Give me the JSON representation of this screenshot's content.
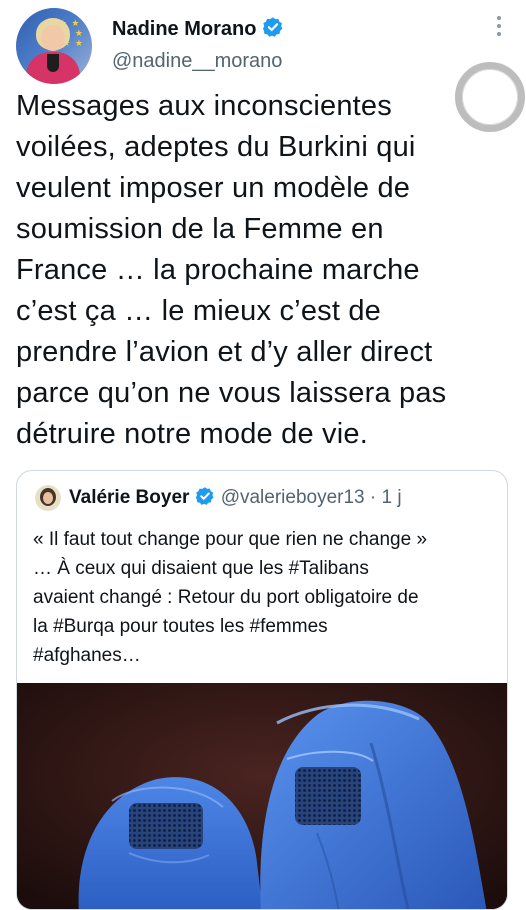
{
  "author": {
    "display_name": "Nadine Morano",
    "handle": "@nadine__morano",
    "verified": true
  },
  "tweet": {
    "lines": [
      "Messages aux inconscientes",
      "voilées, adeptes du Burkini qui",
      "veulent imposer un modèle de",
      "soumission de la Femme en",
      "France … la prochaine marche",
      "c’est ça … le mieux c’est de",
      "prendre l’avion et d’y aller direct",
      "parce qu’on ne vous laissera pas",
      "détruire notre mode de vie."
    ]
  },
  "quoted_tweet": {
    "display_name": "Valérie Boyer",
    "handle": "@valerieboyer13",
    "separator": "·",
    "time": "1 j",
    "verified": true,
    "lines": [
      "« Il faut tout change pour que rien ne change »",
      "… À ceux qui disaient que les #Talibans",
      "avaient changé : Retour du port obligatoire de",
      "la #Burqa pour toutes les #femmes",
      "#afghanes…"
    ]
  },
  "colors": {
    "text": "#0f1419",
    "secondary": "#536471",
    "verified": "#1d9bf0",
    "border": "#cfd9de",
    "burqa_blue": "#3a6fd1"
  },
  "icons": {
    "verified": "verified-badge-icon",
    "more": "more-vertical-icon",
    "overlay": "record-ring-icon"
  }
}
